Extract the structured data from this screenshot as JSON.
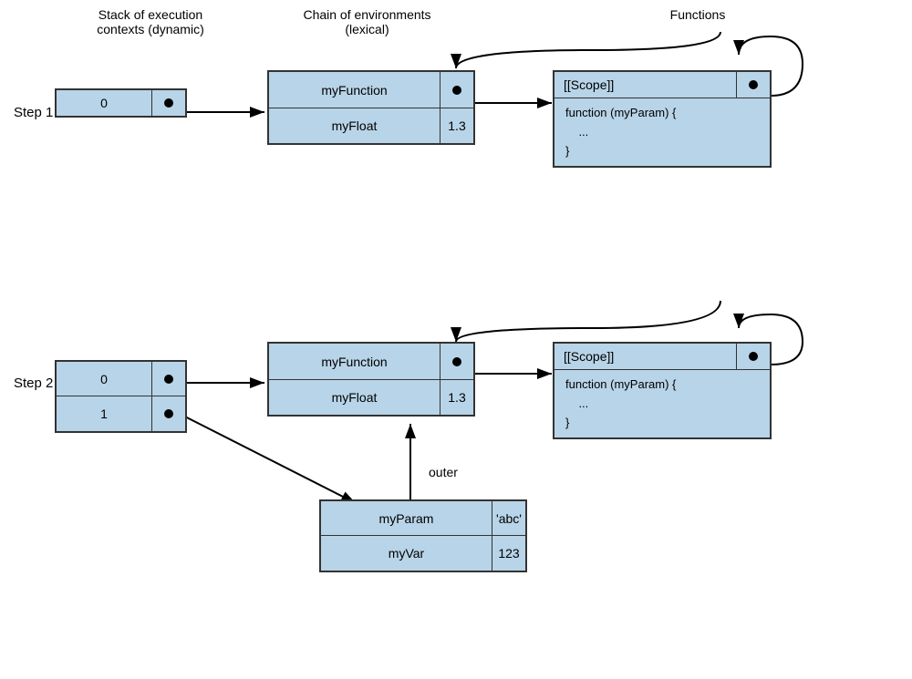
{
  "headers": {
    "stack": "Stack of execution\ncontexts (dynamic)",
    "chain": "Chain of environments\n(lexical)",
    "functions": "Functions"
  },
  "step1": {
    "label": "Step 1",
    "stack": [
      {
        "left": "0",
        "right": "dot"
      }
    ],
    "env": [
      {
        "left": "myFunction",
        "right": "dot"
      },
      {
        "left": "myFloat",
        "right": "1.3"
      }
    ],
    "func": {
      "scope": "[[Scope]]",
      "body": "function (myParam) {\n    ...\n}"
    }
  },
  "step2": {
    "label": "Step 2",
    "stack": [
      {
        "left": "0",
        "right": "dot"
      },
      {
        "left": "1",
        "right": "dot"
      }
    ],
    "env": [
      {
        "left": "myFunction",
        "right": "dot"
      },
      {
        "left": "myFloat",
        "right": "1.3"
      }
    ],
    "inner_env": [
      {
        "left": "myParam",
        "right": "'abc'"
      },
      {
        "left": "myVar",
        "right": "123"
      }
    ],
    "func": {
      "scope": "[[Scope]]",
      "body": "function (myParam) {\n    ...\n}"
    },
    "outer_label": "outer"
  }
}
